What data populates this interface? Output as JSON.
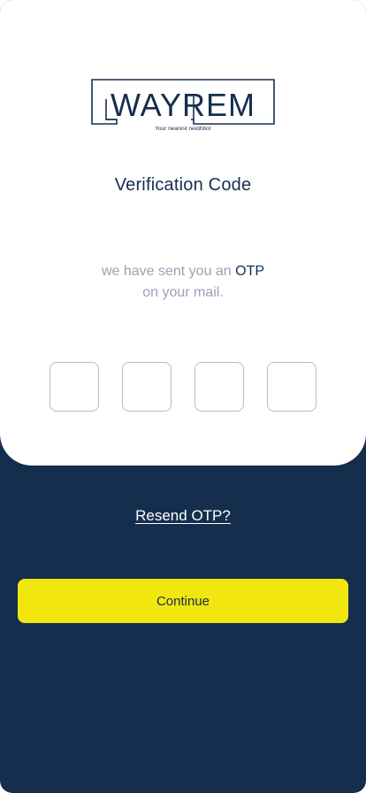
{
  "logo": {
    "wordmark": "WAYREM",
    "tagline": "Your nearest neighbor"
  },
  "title": "Verification Code",
  "message": {
    "part1": "we have sent you an ",
    "highlight": "OTP",
    "line2": "on your mail."
  },
  "otp": {
    "digits": [
      "",
      "",
      "",
      ""
    ]
  },
  "resend_label": "Resend OTP?",
  "continue_label": "Continue",
  "colors": {
    "navy": "#152e4e",
    "accent_yellow": "#f2e60f",
    "muted_text": "#9aa3b5",
    "card": "#ffffff"
  }
}
